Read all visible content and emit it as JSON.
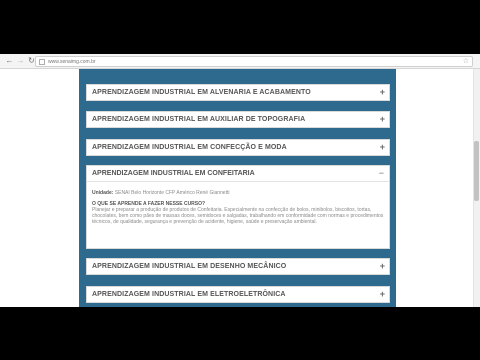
{
  "browser": {
    "url": "www.senaimg.com.br"
  },
  "accordion": {
    "items": [
      {
        "title": "APRENDIZAGEM INDUSTRIAL EM ALVENARIA E ACABAMENTO",
        "toggle": "+"
      },
      {
        "title": "APRENDIZAGEM INDUSTRIAL EM AUXILIAR DE TOPOGRAFIA",
        "toggle": "+"
      },
      {
        "title": "APRENDIZAGEM INDUSTRIAL EM CONFECÇÃO E MODA",
        "toggle": "+"
      },
      {
        "title": "APRENDIZAGEM INDUSTRIAL EM DESENHO MECÂNICO",
        "toggle": "+"
      },
      {
        "title": "APRENDIZAGEM INDUSTRIAL EM ELETROELETRÔNICA",
        "toggle": "+"
      }
    ],
    "open": {
      "title": "APRENDIZAGEM INDUSTRIAL EM CONFEITARIA",
      "toggle": "−",
      "unit_label": "Unidade:",
      "unit_value": "SENAI Belo Horizonte CFP Américo René Giannetti",
      "question": "O QUE SE APRENDE A FAZER NESSE CURSO?",
      "description": "Planejar e preparar a produção de produtos de Confeitaria. Especialmente na confecção de bolos, minibolos, biscoitos, tortas, chocolates, bem como pães de massas doces, semidoces e salgadas, trabalhando em conformidade com normas e procedimentos técnicos, de qualidade, segurança e prevenção de acidente, higiene, saúde e preservação ambiental."
    }
  }
}
